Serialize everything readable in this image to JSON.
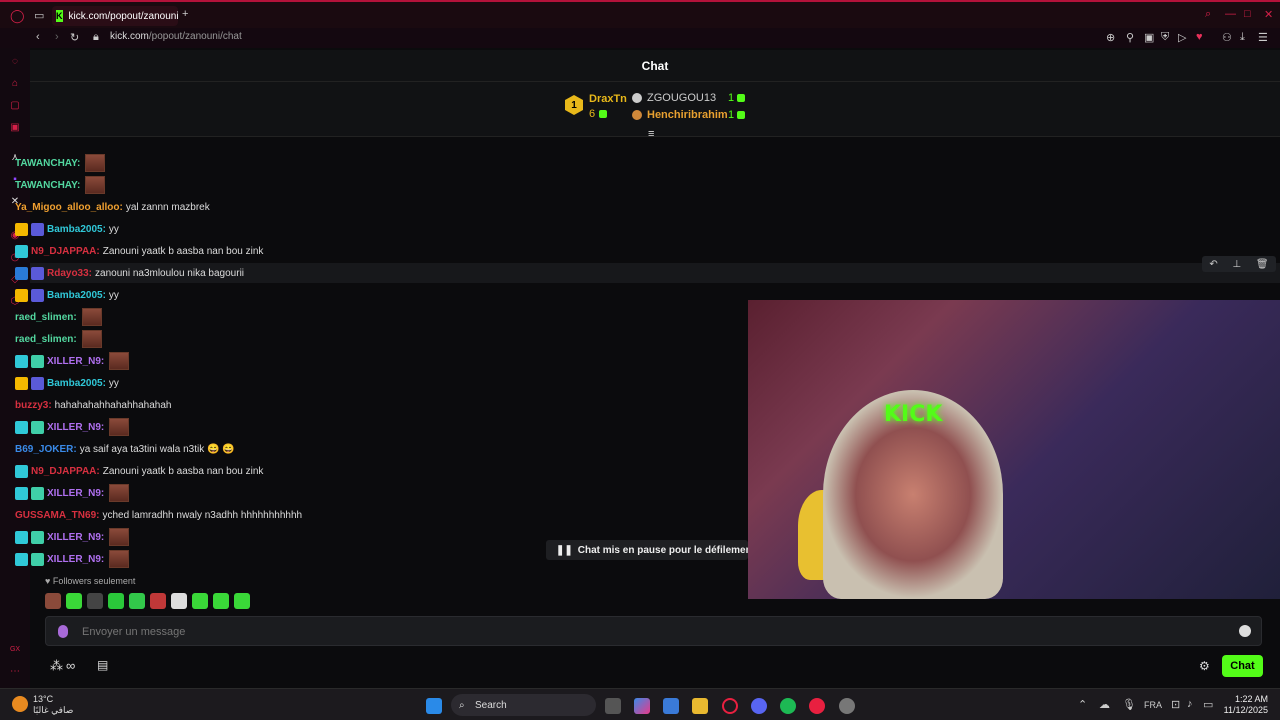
{
  "browser": {
    "tab_title": "kick.com/popout/zanouni",
    "url_host": "kick.com",
    "url_path": "/popout/zanouni/chat",
    "accent": "#b3123a"
  },
  "chat": {
    "header_title": "Chat",
    "leaderboard": {
      "first_rank": "1",
      "first_name": "DraxTn",
      "first_count": "6",
      "second_name": "ZGOUGOU13",
      "second_count": "1",
      "third_name": "Henchiribrahim",
      "third_count": "1"
    },
    "messages": [
      {
        "user": "TAWANCHAY:",
        "text": "",
        "color": "#53d8a0",
        "emote": true,
        "badges": []
      },
      {
        "user": "TAWANCHAY:",
        "text": "",
        "color": "#53d8a0",
        "emote": true,
        "badges": []
      },
      {
        "user": "Ya_Migoo_alloo_alloo:",
        "text": "yal zannn mazbrek",
        "color": "#f0a030",
        "emote": false,
        "badges": []
      },
      {
        "user": "Bamba2005:",
        "text": "yy",
        "color": "#30c8d8",
        "emote": false,
        "badges": [
          "gold",
          "ppl"
        ]
      },
      {
        "user": "N9_DJAPPAA:",
        "text": "Zanouni yaatk b aasba nan bou zink",
        "color": "#d83040",
        "emote": false,
        "badges": [
          "cyan"
        ]
      },
      {
        "user": "Rdayo33:",
        "text": "zanouni na3mloulou nika bagourii",
        "color": "#d83040",
        "emote": false,
        "badges": [
          "blue",
          "ppl"
        ]
      },
      {
        "user": "Bamba2005:",
        "text": "yy",
        "color": "#30c8d8",
        "emote": false,
        "badges": [
          "gold",
          "ppl"
        ]
      },
      {
        "user": "raed_slimen:",
        "text": "",
        "color": "#53d8a0",
        "emote": true,
        "badges": []
      },
      {
        "user": "raed_slimen:",
        "text": "",
        "color": "#53d8a0",
        "emote": true,
        "badges": []
      },
      {
        "user": "XILLER_N9:",
        "text": "",
        "color": "#b070f0",
        "emote": true,
        "badges": [
          "cyan",
          "grn"
        ]
      },
      {
        "user": "Bamba2005:",
        "text": "yy",
        "color": "#30c8d8",
        "emote": false,
        "badges": [
          "gold",
          "ppl"
        ]
      },
      {
        "user": "buzzy3:",
        "text": "hahahahahhahahhahahah",
        "color": "#d83040",
        "emote": false,
        "badges": []
      },
      {
        "user": "XILLER_N9:",
        "text": "",
        "color": "#b070f0",
        "emote": true,
        "badges": [
          "cyan",
          "grn"
        ]
      },
      {
        "user": "B69_JOKER:",
        "text": "ya saif aya ta3tini wala n3tik 😄 😄",
        "color": "#3a8ae8",
        "emote": false,
        "badges": []
      },
      {
        "user": "N9_DJAPPAA:",
        "text": "Zanouni yaatk b aasba nan bou zink",
        "color": "#d83040",
        "emote": false,
        "badges": [
          "cyan"
        ]
      },
      {
        "user": "XILLER_N9:",
        "text": "",
        "color": "#b070f0",
        "emote": true,
        "badges": [
          "cyan",
          "grn"
        ]
      },
      {
        "user": "GUSSAMA_TN69:",
        "text": "yched lamradhh nwaly n3adhh hhhhhhhhhhh",
        "color": "#d83040",
        "emote": false,
        "badges": []
      },
      {
        "user": "XILLER_N9:",
        "text": "",
        "color": "#b070f0",
        "emote": true,
        "badges": [
          "cyan",
          "grn"
        ]
      },
      {
        "user": "XILLER_N9:",
        "text": "",
        "color": "#b070f0",
        "emote": true,
        "badges": [
          "cyan",
          "grn"
        ]
      }
    ],
    "pause_notice": "Chat mis en pause pour le défilement",
    "followers_only": "Followers seulement",
    "input_placeholder": "Envoyer un message",
    "send_label": "Chat",
    "brand_green": "#53fc18"
  },
  "overlay": {
    "stream_sign_text": "KICK"
  },
  "taskbar": {
    "weather_temp": "13°C",
    "weather_desc": "صافي غالبًا",
    "search_label": "Search",
    "lang": "FRA",
    "time": "1:22 AM",
    "date": "11/12/2025"
  }
}
